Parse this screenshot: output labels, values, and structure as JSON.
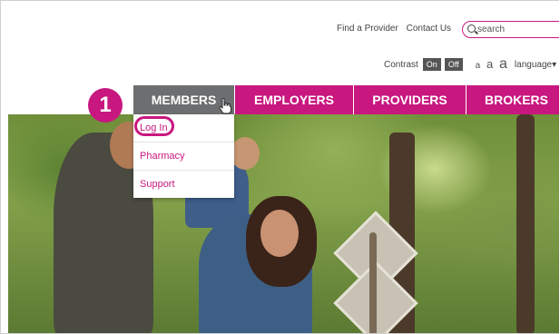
{
  "utility": {
    "links": [
      "Find a Provider",
      "Contact Us"
    ],
    "search_placeholder": "search"
  },
  "accessibility": {
    "contrast_label": "Contrast",
    "on_label": "On",
    "off_label": "Off",
    "size_small": "a",
    "size_medium": "a",
    "size_large": "a",
    "language_label": "language"
  },
  "nav": {
    "members": "MEMBERS",
    "employers": "EMPLOYERS",
    "providers": "PROVIDERS",
    "brokers": "BROKERS"
  },
  "dropdown": {
    "items": [
      "Log In",
      "Pharmacy",
      "Support"
    ]
  },
  "step_badge": "1",
  "colors": {
    "brand": "#c8177f",
    "nav_active": "#6d6e70"
  },
  "icons": {
    "search": "magnifier-icon",
    "cursor": "hand-pointer-icon"
  }
}
